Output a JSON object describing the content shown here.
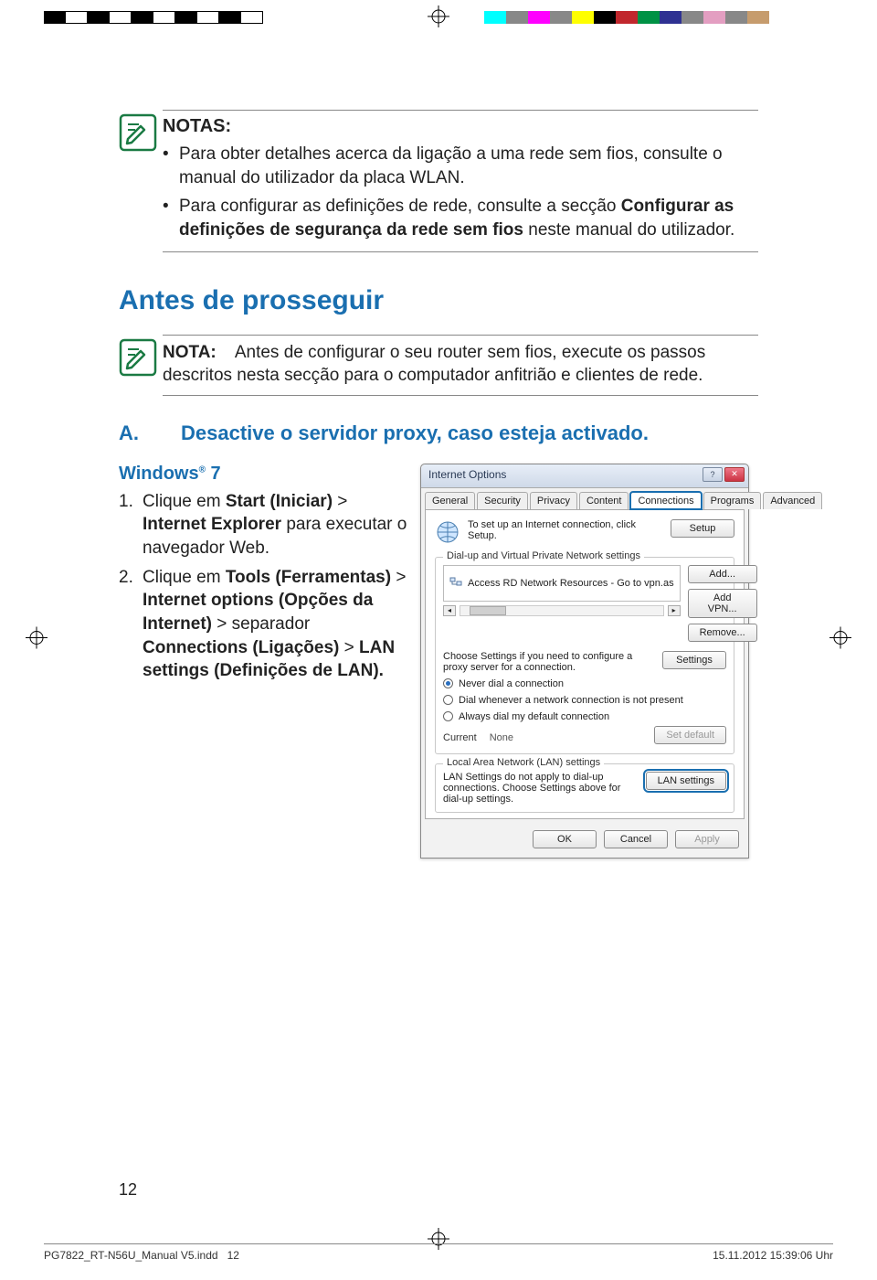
{
  "notas": {
    "title": "NOTAS:",
    "bullet1": "Para obter detalhes acerca da ligação a uma rede sem fios, consulte o manual do utilizador da placa WLAN.",
    "bullet2_pre": "Para configurar as definições de rede, consulte a secção ",
    "bullet2_bold": "Configurar as definições de segurança da rede sem fios",
    "bullet2_post": " neste manual do utilizador."
  },
  "antes_heading": "Antes de prosseguir",
  "nota2": {
    "label": "NOTA:",
    "text": " Antes de configurar o seu router sem fios, execute os passos descritos nesta secção para o computador anfitrião e clientes de rede."
  },
  "section_a": {
    "letter": "A.",
    "text": "Desactive o servidor proxy, caso esteja activado."
  },
  "win7": {
    "title": "Windows",
    "reg": "®",
    "ver": " 7",
    "item1_pre": "Clique em ",
    "item1_b1": "Start (Iniciar)",
    "item1_mid": " > ",
    "item1_b2": "Internet Explorer",
    "item1_post": " para executar o navegador Web.",
    "item2_pre": "Clique em ",
    "item2_b1": "Tools (Ferramentas)",
    "item2_m1": " > ",
    "item2_b2": "Internet options (Opções da Internet)",
    "item2_m2": " > separador ",
    "item2_b3": "Connections (Ligações)",
    "item2_m3": " > ",
    "item2_b4": "LAN settings (Definições de LAN)."
  },
  "iop": {
    "title": "Internet Options",
    "tabs": [
      "General",
      "Security",
      "Privacy",
      "Content",
      "Connections",
      "Programs",
      "Advanced"
    ],
    "setup_text": "To set up an Internet connection, click Setup.",
    "setup_btn": "Setup",
    "grp_dialup": "Dial-up and Virtual Private Network settings",
    "conn_item": "Access RD Network Resources - Go to vpn.as",
    "add": "Add...",
    "addvpn": "Add VPN...",
    "remove": "Remove...",
    "proxy_text": "Choose Settings if you need to configure a proxy server for a connection.",
    "settings": "Settings",
    "r1": "Never dial a connection",
    "r2": "Dial whenever a network connection is not present",
    "r3": "Always dial my default connection",
    "current_lbl": "Current",
    "current_val": "None",
    "setdef": "Set default",
    "grp_lan": "Local Area Network (LAN) settings",
    "lan_text": "LAN Settings do not apply to dial-up connections. Choose Settings above for dial-up settings.",
    "lan_btn": "LAN settings",
    "ok": "OK",
    "cancel": "Cancel",
    "apply": "Apply"
  },
  "page_num": "12",
  "footer": {
    "left_a": "PG7822_RT-N56U_Manual V5.indd",
    "left_b": "12",
    "right": "15.11.2012   15:39:06 Uhr"
  }
}
